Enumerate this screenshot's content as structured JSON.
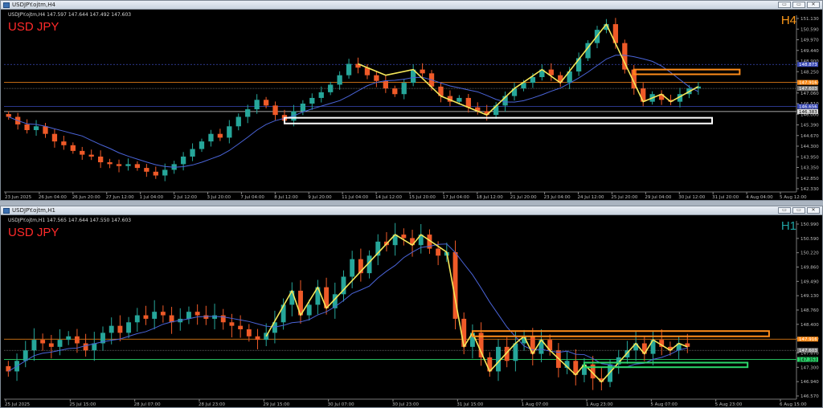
{
  "windows": [
    {
      "title": "USDJPY.ojtm,H4",
      "ohlc": "USDJPY.ojtm,H4  147.597 147.644 147.492 147.603",
      "symbol": "USD JPY",
      "timeframe": "H4",
      "timeframe_color": "#ff9a1a"
    },
    {
      "title": "USDJPY.ojtm,H1",
      "ohlc": "USDJPY.ojtm,H1  147.565 147.644 147.550 147.603",
      "symbol": "USD JPY",
      "timeframe": "H1",
      "timeframe_color": "#1fa3a3"
    }
  ],
  "window_buttons": [
    "▭",
    "▭",
    "✕"
  ],
  "colors": {
    "bull": "#26a69a",
    "bear": "#ef5a28",
    "ma": "#4a64d8",
    "zigzag": "#f5e85a",
    "orange_line": "#ff8c1a",
    "white_zone": "#ffffff",
    "green_zone": "#2bd66a",
    "grid": "#2a2a2a"
  },
  "chart_data": [
    {
      "type": "candlestick",
      "title": "USDJPY.ojtm,H4",
      "ylim": [
        142.3,
        151.3
      ],
      "y_ticks": [
        "151.130",
        "150.590",
        "149.970",
        "149.440",
        "148.900",
        "148.250",
        "147.610",
        "147.060",
        "146.510",
        "146.000",
        "145.390",
        "144.670",
        "144.300",
        "143.950",
        "143.350",
        "142.850",
        "142.330"
      ],
      "x_labels": [
        "23 Jun 2025",
        "26 Jun 04:00",
        "26 Jun 20:00",
        "27 Jun 12:00",
        "1 Jul 04:00",
        "2 Jul 12:00",
        "3 Jul 20:00",
        "7 Jul 04:00",
        "8 Jul 12:00",
        "9 Jul 20:00",
        "11 Jul 04:00",
        "14 Jul 12:00",
        "15 Jul 20:00",
        "17 Jul 04:00",
        "18 Jul 12:00",
        "21 Jul 20:00",
        "23 Jul 04:00",
        "24 Jul 12:00",
        "25 Jul 20:00",
        "29 Jul 04:00",
        "30 Jul 12:00",
        "31 Jul 20:00",
        "4 Aug 04:00",
        "5 Aug 12:00"
      ],
      "price_labels": [
        {
          "value": 148.87,
          "text": "148.873",
          "color": "#3a4ab8"
        },
        {
          "value": 147.92,
          "text": "147.916",
          "color": "#ff8c1a"
        },
        {
          "value": 147.6,
          "text": "147.603",
          "color": "#777777"
        },
        {
          "value": 146.65,
          "text": "146.656",
          "color": "#3a4ab8"
        },
        {
          "value": 146.38,
          "text": "146.383",
          "color": "#dddddd"
        }
      ],
      "close": [
        146.1,
        145.7,
        145.4,
        145.6,
        145.2,
        144.8,
        144.6,
        144.3,
        144.1,
        144.0,
        143.7,
        143.6,
        143.5,
        143.6,
        143.4,
        143.2,
        143.0,
        143.3,
        143.6,
        144.0,
        144.4,
        144.8,
        145.2,
        145.0,
        145.6,
        146.1,
        146.5,
        147.0,
        146.7,
        146.2,
        145.9,
        146.4,
        146.8,
        147.1,
        147.4,
        147.8,
        148.3,
        148.9,
        148.7,
        148.3,
        148.0,
        147.6,
        147.3,
        147.9,
        148.6,
        148.4,
        147.7,
        147.2,
        146.9,
        147.1,
        146.6,
        146.4,
        146.2,
        146.7,
        147.2,
        147.6,
        147.9,
        148.2,
        148.6,
        148.3,
        147.9,
        148.5,
        149.2,
        150.0,
        150.7,
        151.0,
        150.0,
        148.6,
        147.6,
        146.9,
        147.3,
        147.0,
        146.9,
        147.3,
        147.6,
        147.7
      ],
      "zigzag": [
        [
          38,
          148.9
        ],
        [
          41,
          148.3
        ],
        [
          44,
          148.6
        ],
        [
          47,
          147.2
        ],
        [
          50,
          146.6
        ],
        [
          52,
          146.2
        ],
        [
          55,
          147.6
        ],
        [
          58,
          148.6
        ],
        [
          60,
          147.9
        ],
        [
          65,
          151.0
        ],
        [
          69,
          146.9
        ],
        [
          71,
          147.3
        ],
        [
          72,
          146.9
        ],
        [
          75,
          147.7
        ]
      ],
      "zones": [
        {
          "kind": "orange",
          "y1": 148.6,
          "y2": 148.35,
          "x1": 68.5,
          "x2": 80
        },
        {
          "kind": "white",
          "y1": 146.05,
          "y2": 145.75,
          "x1": 30.5,
          "x2": 77
        }
      ],
      "xlim": [
        0,
        86
      ]
    },
    {
      "type": "candlestick",
      "title": "USDJPY.ojtm,H1",
      "ylim": [
        146.3,
        151.2
      ],
      "y_ticks": [
        "150.990",
        "150.590",
        "150.220",
        "149.860",
        "149.490",
        "149.130",
        "148.760",
        "148.400",
        "148.030",
        "147.670",
        "147.300",
        "146.940",
        "146.570"
      ],
      "x_labels": [
        "25 Jul 2025",
        "25 Jul 15:00",
        "28 Jul 07:00",
        "28 Jul 23:00",
        "29 Jul 15:00",
        "30 Jul 07:00",
        "30 Jul 23:00",
        "31 Jul 15:00",
        "1 Aug 07:00",
        "1 Aug 23:00",
        "5 Aug 07:00",
        "5 Aug 23:00",
        "6 Aug 15:00"
      ],
      "price_labels": [
        {
          "value": 147.92,
          "text": "147.916",
          "color": "#ff8c1a"
        },
        {
          "value": 147.6,
          "text": "147.603",
          "color": "#777777"
        },
        {
          "value": 147.34,
          "text": "147.353",
          "color": "#2bd66a"
        }
      ],
      "close": [
        147.0,
        147.3,
        147.6,
        147.9,
        147.8,
        147.7,
        147.9,
        148.0,
        147.8,
        147.6,
        147.8,
        148.1,
        148.3,
        148.1,
        148.4,
        148.6,
        148.5,
        148.7,
        148.6,
        148.4,
        148.5,
        148.7,
        148.6,
        148.5,
        148.6,
        148.4,
        148.3,
        148.2,
        148.0,
        147.9,
        148.1,
        148.4,
        148.9,
        149.3,
        148.6,
        148.9,
        149.4,
        148.8,
        149.2,
        149.7,
        150.2,
        149.8,
        150.3,
        150.7,
        150.6,
        150.9,
        150.8,
        150.6,
        150.9,
        150.5,
        150.3,
        150.4,
        148.5,
        147.7,
        148.1,
        147.4,
        147.0,
        147.7,
        147.3,
        147.8,
        148.0,
        147.5,
        147.9,
        147.6,
        147.1,
        147.3,
        146.9,
        147.2,
        146.8,
        146.7,
        147.2,
        147.4,
        147.6,
        147.8,
        147.5,
        147.9,
        147.7,
        147.6,
        147.8,
        147.7
      ],
      "zigzag": [
        [
          30,
          148.0
        ],
        [
          33,
          149.3
        ],
        [
          34,
          148.6
        ],
        [
          36,
          149.4
        ],
        [
          37,
          148.8
        ],
        [
          45,
          150.9
        ],
        [
          47,
          150.6
        ],
        [
          48,
          150.9
        ],
        [
          51,
          150.4
        ],
        [
          53,
          147.7
        ],
        [
          54,
          148.1
        ],
        [
          56,
          147.0
        ],
        [
          59,
          147.8
        ],
        [
          60,
          148.0
        ],
        [
          61,
          147.5
        ],
        [
          62,
          147.9
        ],
        [
          63,
          147.6
        ],
        [
          66,
          146.9
        ],
        [
          67,
          147.2
        ],
        [
          69,
          146.7
        ],
        [
          73,
          147.8
        ],
        [
          74,
          147.5
        ],
        [
          75,
          147.9
        ],
        [
          77,
          147.6
        ],
        [
          78,
          147.8
        ],
        [
          79,
          147.7
        ]
      ],
      "zones": [
        {
          "kind": "orange",
          "y1": 148.15,
          "y2": 148.0,
          "x1": 54.5,
          "x2": 89
        },
        {
          "kind": "green",
          "y1": 147.25,
          "y2": 147.12,
          "x1": 67.5,
          "x2": 86.5
        }
      ],
      "xlim": [
        0,
        92
      ]
    }
  ]
}
